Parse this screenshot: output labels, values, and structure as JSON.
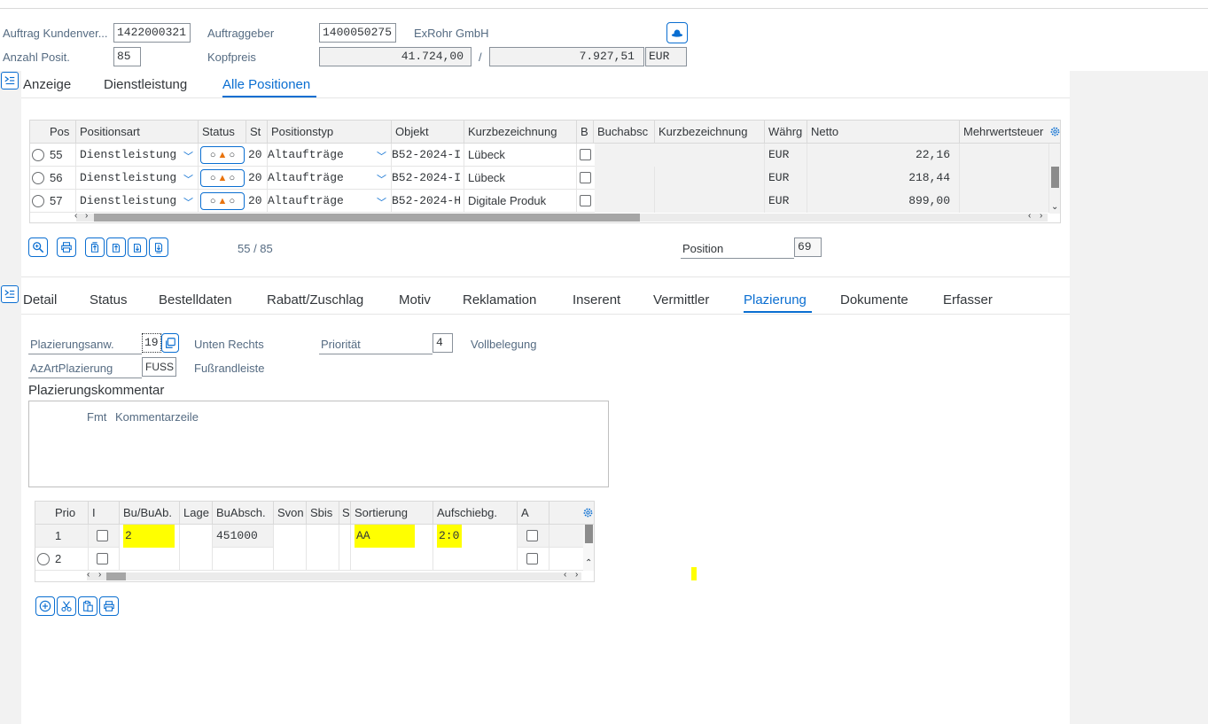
{
  "header": {
    "order_label": "Auftrag Kundenver...",
    "order_value": "1422000321",
    "client_label": "Auftraggeber",
    "client_value": "1400050275",
    "client_name": "ExRohr GmbH",
    "count_label": "Anzahl Posit.",
    "count_value": "85",
    "price_label": "Kopfpreis",
    "price_value": "41.724,00",
    "price_sep": "/",
    "price_value2": "7.927,51",
    "currency": "EUR"
  },
  "top_tabs": [
    {
      "label": "Anzeige"
    },
    {
      "label": "Dienstleistung"
    },
    {
      "label": "Alle Positionen"
    }
  ],
  "positions_grid": {
    "columns": [
      "Pos",
      "Positionsart",
      "Status",
      "St",
      "Positionstyp",
      "Objekt",
      "Kurzbezeichnung",
      "B",
      "Buchabsc",
      "Kurzbezeichnung",
      "Währg",
      "Netto",
      "Mehrwertsteuer"
    ],
    "rows": [
      {
        "pos": "55",
        "art": "Dienstleistung",
        "st": "20",
        "typ": "Altaufträge",
        "objekt": "B52-2024-I",
        "kurz": "Lübeck",
        "waehrung": "EUR",
        "netto": "22,16"
      },
      {
        "pos": "56",
        "art": "Dienstleistung",
        "st": "20",
        "typ": "Altaufträge",
        "objekt": "B52-2024-I",
        "kurz": "Lübeck",
        "waehrung": "EUR",
        "netto": "218,44"
      },
      {
        "pos": "57",
        "art": "Dienstleistung",
        "st": "20",
        "typ": "Altaufträge",
        "objekt": "B52-2024-H",
        "kurz": "Digitale Produk",
        "waehrung": "EUR",
        "netto": "899,00"
      }
    ],
    "status_icon": "○▲○"
  },
  "pager": {
    "text": "55 / 85",
    "position_label": "Position",
    "position_value": "69"
  },
  "detail_tabs": [
    {
      "label": "Detail"
    },
    {
      "label": "Status"
    },
    {
      "label": "Bestelldaten"
    },
    {
      "label": "Rabatt/Zuschlag"
    },
    {
      "label": "Motiv"
    },
    {
      "label": "Reklamation"
    },
    {
      "label": "Inserent"
    },
    {
      "label": "Vermittler"
    },
    {
      "label": "Plazierung"
    },
    {
      "label": "Dokumente"
    },
    {
      "label": "Erfasser"
    }
  ],
  "placement": {
    "anw_label": "Plazierungsanw.",
    "anw_value": "19",
    "anw_text": "Unten Rechts",
    "prio_label": "Priorität",
    "prio_value": "4",
    "prio_text": "Vollbelegung",
    "azart_label": "AzArtPlazierung",
    "azart_value": "FUSS",
    "azart_text": "Fußrandleiste",
    "comment_label": "Plazierungskommentar",
    "comment_fmt": "Fmt",
    "comment_col": "Kommentarzeile"
  },
  "prio_grid": {
    "columns": [
      "Prio",
      "I",
      "Bu/BuAb.",
      "Lage",
      "BuAbsch.",
      "Svon",
      "Sbis",
      "S",
      "Sortierung",
      "Aufschiebg.",
      "A"
    ],
    "rows": [
      {
        "prio": "1",
        "bu": "2",
        "buabsch": "451000",
        "sort": "AA",
        "aufsch": "2:0"
      },
      {
        "prio": "2",
        "bu": "",
        "buabsch": "",
        "sort": "",
        "aufsch": ""
      }
    ]
  },
  "colors": {
    "accent": "#0a6ed1",
    "highlight": "#ffff00",
    "label": "#556b82"
  }
}
